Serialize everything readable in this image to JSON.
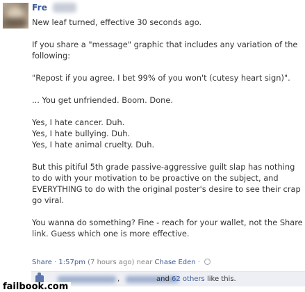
{
  "post": {
    "author_visible": "Fre",
    "paragraphs": [
      "New leaf turned, effective 30 seconds ago.",
      "If you share a \"message\" graphic that includes any variation of the following:",
      "\"Repost if you agree. I bet 99% of you won't (cutesy heart sign)\".",
      "... You get unfriended. Boom. Done.",
      "Yes, I hate cancer. Duh.\nYes, I hate bullying. Duh.\nYes, I hate animal cruelty. Duh.",
      "But this pitiful 5th grade passive-aggressive guilt slap has nothing to do with your motivation to be proactive on the subject, and EVERYTHING to do with the original poster's desire to see their crap go viral.",
      "You wanna do something? Fine - reach for your wallet, not the Share link. Guess which one is more effective."
    ]
  },
  "meta": {
    "share_label": "Share",
    "separator": "·",
    "time": "1:57pm",
    "time_ago": "(7 hours ago)",
    "location_prefix": "near",
    "location": "Chase Eden",
    "separator2": "·"
  },
  "likes": {
    "comma": ",",
    "and": "and",
    "others_link": "62 others",
    "suffix": "like this."
  },
  "watermark": "failbook.com"
}
